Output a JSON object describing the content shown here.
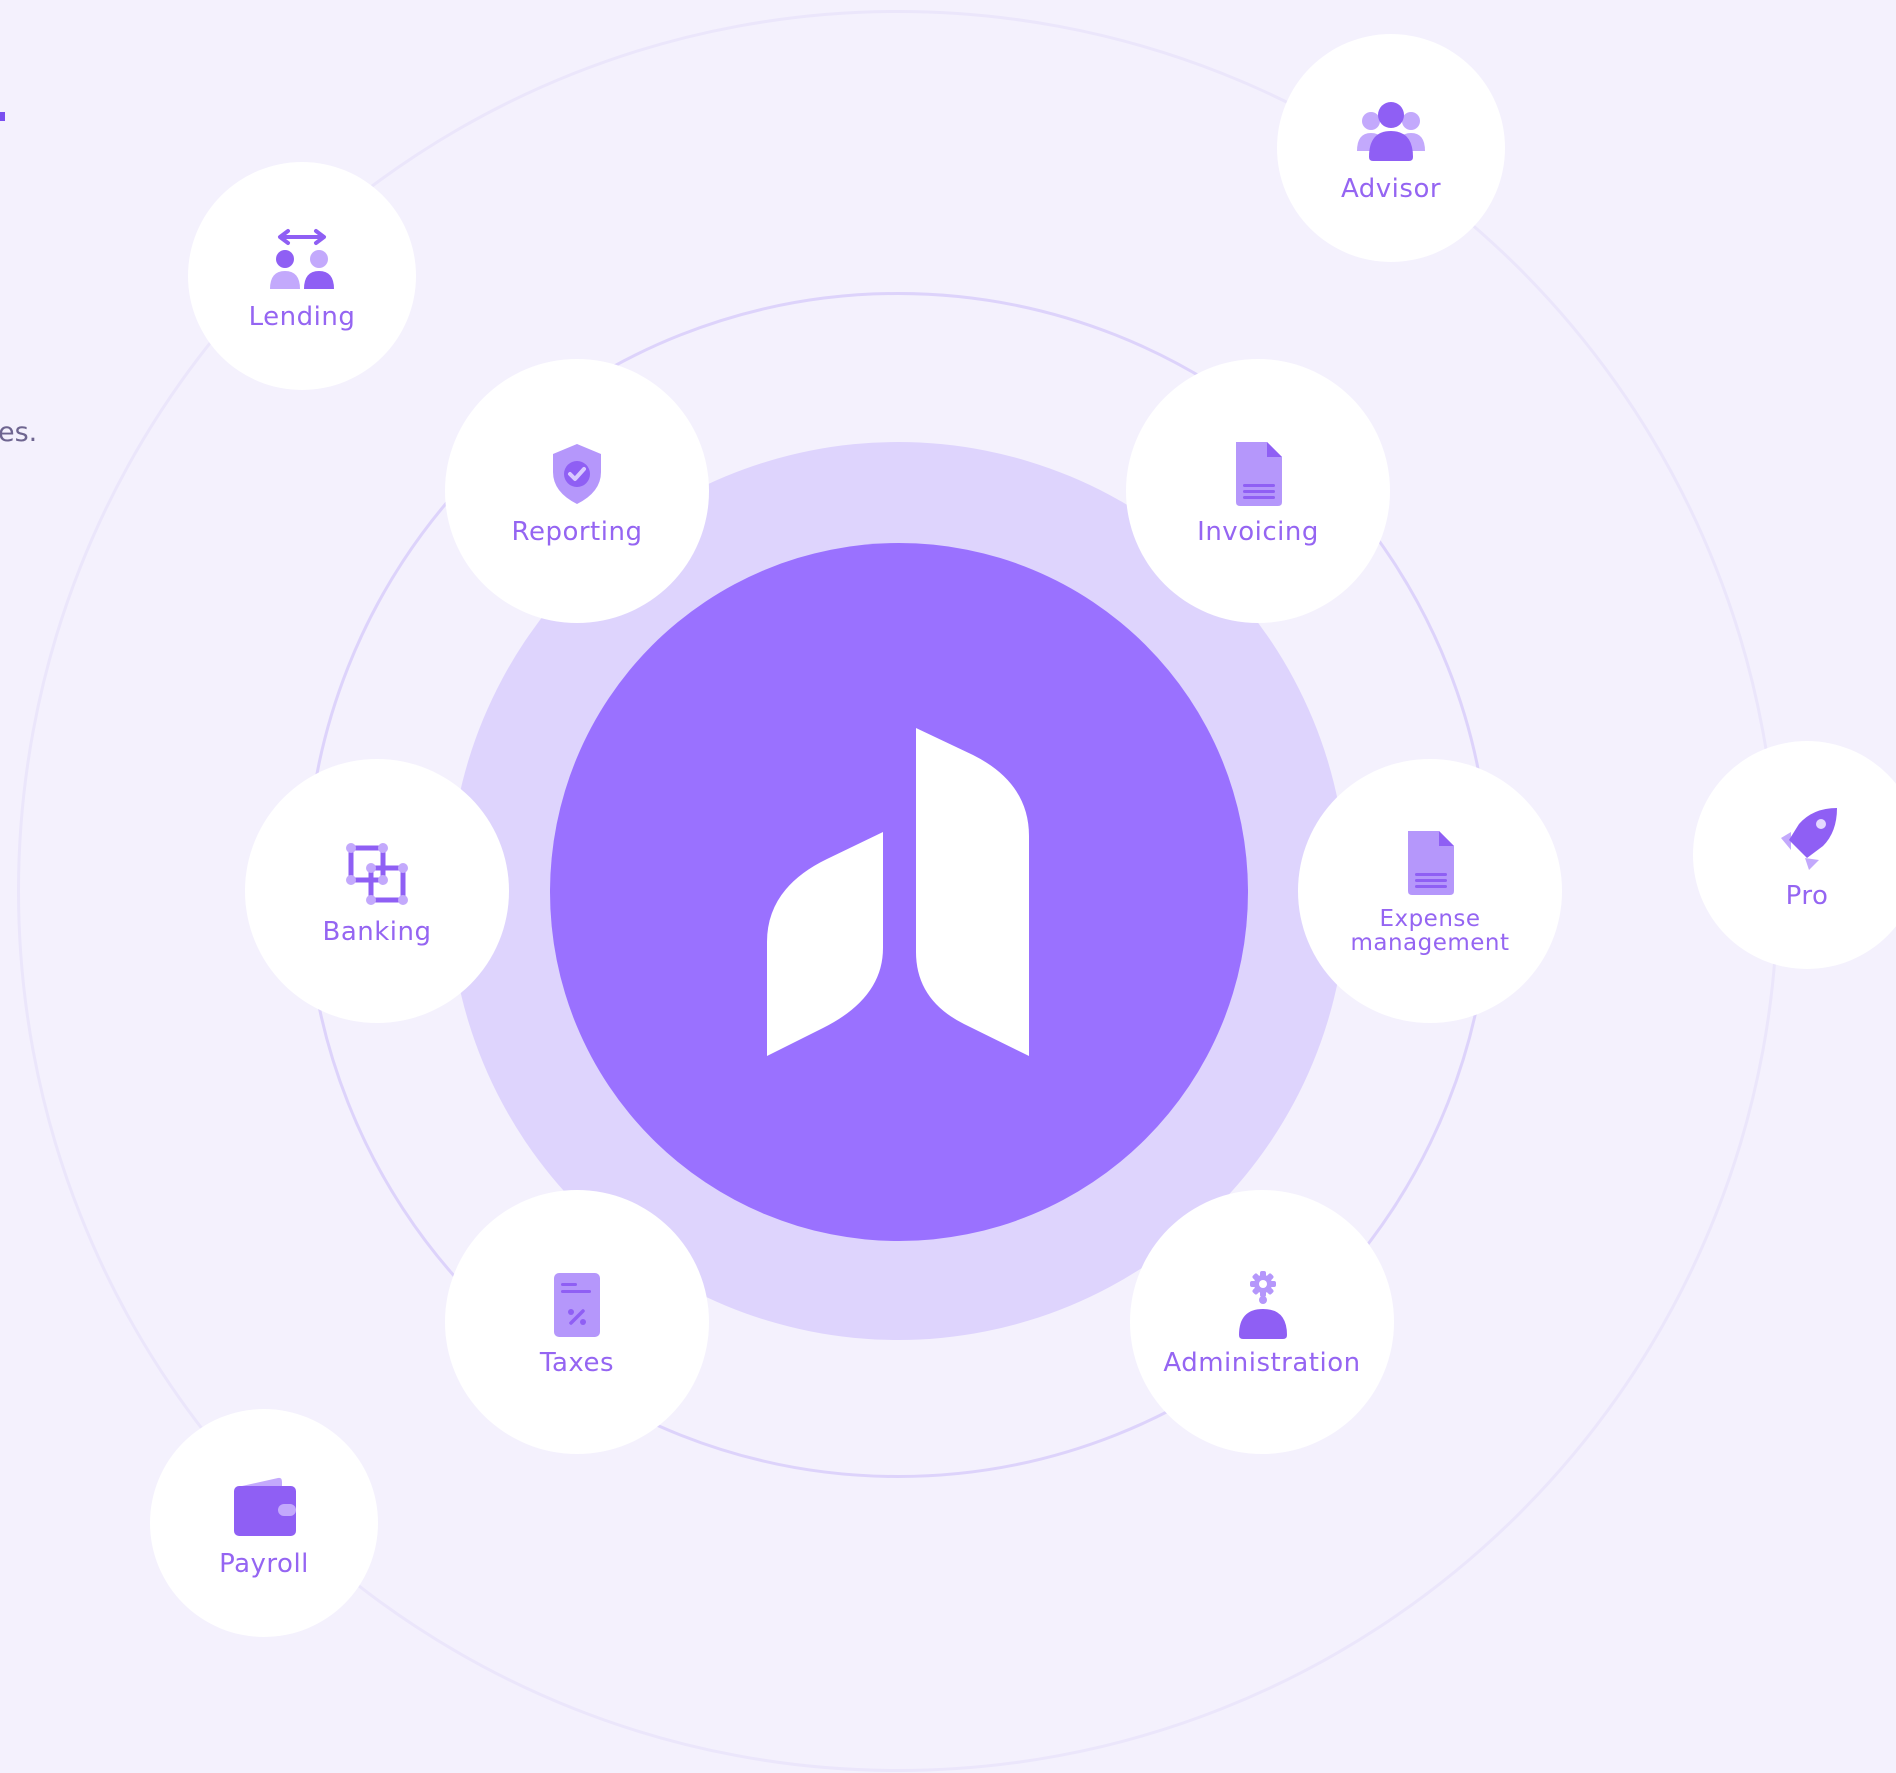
{
  "background_color": "#f4f1fd",
  "accent_color": "#9a71ff",
  "halo_color": "#ded4fd",
  "label_color": "#9565f2",
  "left_text_fragment": "es.",
  "center": {
    "icon": "brand-logo"
  },
  "inner_ring": [
    {
      "id": "reporting",
      "label": "Reporting",
      "icon": "shield-check-icon"
    },
    {
      "id": "invoicing",
      "label": "Invoicing",
      "icon": "document-icon"
    },
    {
      "id": "banking",
      "label": "Banking",
      "icon": "connected-squares-icon"
    },
    {
      "id": "expense-management",
      "label": "Expense\nmanagement",
      "icon": "document-icon"
    },
    {
      "id": "taxes",
      "label": "Taxes",
      "icon": "tax-document-icon"
    },
    {
      "id": "administration",
      "label": "Administration",
      "icon": "user-gear-icon"
    }
  ],
  "outer_ring": [
    {
      "id": "advisor",
      "label": "Advisor",
      "icon": "user-group-icon"
    },
    {
      "id": "lending",
      "label": "Lending",
      "icon": "users-exchange-icon"
    },
    {
      "id": "pro",
      "label": "Pro",
      "icon": "rocket-icon"
    },
    {
      "id": "payroll",
      "label": "Payroll",
      "icon": "wallet-icon"
    }
  ]
}
